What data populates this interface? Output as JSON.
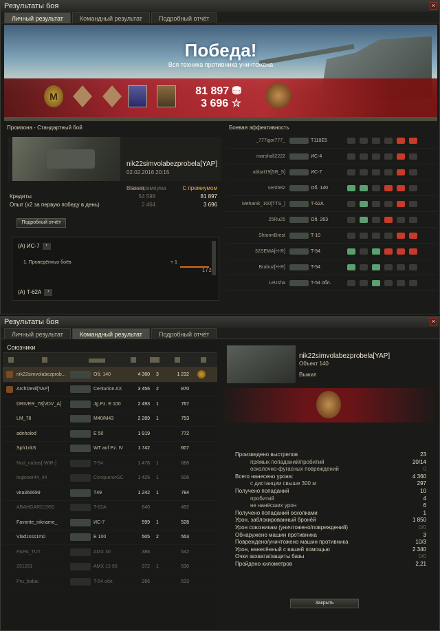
{
  "w1": {
    "title": "Результаты боя",
    "tabs": [
      "Личный результат",
      "Командный результат",
      "Подробный отчёт"
    ],
    "banner": {
      "title": "Победа!",
      "subtitle": "Вся техника противника уничтожена",
      "medal1": "M",
      "credits": "81 897",
      "xp": "3 696"
    },
    "left": {
      "header": "Промзона - Стандартный бой",
      "player": "nik22simvolabezprobela[YAP]",
      "date": "02.02.2016 20:15",
      "status": "Выжил",
      "col1": "Без премиума",
      "col2": "С премиумом",
      "rows": [
        {
          "label": "Кредиты",
          "v1": "54 598",
          "v2": "81 897"
        },
        {
          "label": "Опыт  (x2 за первую победу в день)",
          "v1": "2 464",
          "v2": "3 696"
        }
      ],
      "detail_button": "Подробный отчёт",
      "quest1": {
        "head": "(А) ИС-7",
        "task": "1. Проведённых боёв",
        "plus": "+ 1",
        "count": "1 / 2"
      },
      "quest2": {
        "head": "(А) T-62A"
      }
    },
    "right": {
      "header": "Боевая эффективность",
      "rows": [
        {
          "name": "_777igor777_",
          "vehicle": "T110E5"
        },
        {
          "name": "marshall2222",
          "vehicle": "ИС-4"
        },
        {
          "name": "abbat19[SB_S]",
          "vehicle": "ИС-7"
        },
        {
          "name": "ser0582",
          "vehicle": "Об. 140"
        },
        {
          "name": "Mehanik_100[TTS_]",
          "vehicle": "T-62A"
        },
        {
          "name": "25Ru25",
          "vehicle": "Об. 263"
        },
        {
          "name": "ShtormBrest",
          "vehicle": "T-10"
        },
        {
          "name": "32SEMA[H-R]",
          "vehicle": "T-54"
        },
        {
          "name": "Brabuz[H-R]",
          "vehicle": "T-54"
        },
        {
          "name": "LeUsha",
          "vehicle": "T-54 обл."
        }
      ]
    }
  },
  "w2": {
    "title": "Результаты боя",
    "tabs": [
      "Личный результат",
      "Командный результат",
      "Подробный отчёт"
    ],
    "allies_header": "Союзники",
    "team": [
      {
        "player": "nik22simvolabezprob...",
        "vehicle": "Об. 140",
        "damage": "4 360",
        "kills": "3",
        "xp": "1 232"
      },
      {
        "player": "ArchDevil[YAP]",
        "vehicle": "Centurion AX",
        "damage": "3 456",
        "kills": "2",
        "xp": "870"
      },
      {
        "player": "DRIVER_78[VDV_A]",
        "vehicle": "Jg.Pz. E 100",
        "damage": "2 493",
        "kills": "1",
        "xp": "767"
      },
      {
        "player": "LM_78",
        "vehicle": "M40/M43",
        "damage": "2 289",
        "kills": "1",
        "xp": "753"
      },
      {
        "player": "adnholod",
        "vehicle": "E 50",
        "damage": "1 919",
        "kills": "",
        "xp": "772"
      },
      {
        "player": "Sph1nkS",
        "vehicle": "WT auf Pz. IV",
        "damage": "1 742",
        "kills": "",
        "xp": "607"
      },
      {
        "player": "Nud_nubas[-WIR-]",
        "vehicle": "T-54",
        "damage": "1 476",
        "kills": "1",
        "xp": "688"
      },
      {
        "player": "legioner44_44",
        "vehicle": "ConquerorGC",
        "damage": "1 425",
        "kills": "1",
        "xp": "506"
      },
      {
        "player": "vira366699",
        "vehicle": "T49",
        "damage": "1 242",
        "kills": "1",
        "xp": "784"
      },
      {
        "player": "ABAHGARD1950",
        "vehicle": "T-62A",
        "damage": "640",
        "kills": "",
        "xp": "492"
      },
      {
        "player": "Favorite_nikname_",
        "vehicle": "ИС-7",
        "damage": "599",
        "kills": "1",
        "xp": "528"
      },
      {
        "player": "Vlad1sss1m0",
        "vehicle": "E 100",
        "damage": "505",
        "kills": "2",
        "xp": "553"
      },
      {
        "player": "PAPA_TUT",
        "vehicle": "AMX 30",
        "damage": "386",
        "kills": "",
        "xp": "542"
      },
      {
        "player": "291291",
        "vehicle": "AMX 13 90",
        "damage": "372",
        "kills": "1",
        "xp": "530"
      },
      {
        "player": "Pru_babai",
        "vehicle": "T-54 обл.",
        "damage": "266",
        "kills": "",
        "xp": "533"
      }
    ],
    "detail": {
      "player": "nik22simvolabezprobela[YAP]",
      "vehicle": "Объект 140",
      "status": "Выжил",
      "stats": [
        {
          "l": "Произведено выстрелов",
          "r": "23"
        },
        {
          "l": "прямых попаданий/пробитий",
          "r": "20/14",
          "ind": true
        },
        {
          "l": "осколочно-фугасных повреждений",
          "r": "0",
          "ind": true,
          "dim": true
        },
        {
          "l": "Всего нанесено урона:",
          "r": "4 360"
        },
        {
          "l": "с дистанции свыше 300 м",
          "r": "297",
          "ind": true
        },
        {
          "l": "Получено попаданий",
          "r": "10"
        },
        {
          "l": "пробитий",
          "r": "4",
          "ind": true
        },
        {
          "l": "не нанёсших урон",
          "r": "6",
          "ind": true
        },
        {
          "l": "Получено попаданий осколками",
          "r": "1"
        },
        {
          "l": "Урон, заблокированный бронёй",
          "r": "1 850"
        },
        {
          "l": "Урон союзникам (уничтожено/повреждений)",
          "r": "0/0",
          "dim": true
        },
        {
          "l": "Обнаружено машин противника",
          "r": "3"
        },
        {
          "l": "Повреждено/уничтожено машин противника",
          "r": "10/3"
        },
        {
          "l": "Урон, нанесённый с вашей помощью",
          "r": "2 340"
        },
        {
          "l": "Очки захвата/защиты базы",
          "r": "0/0",
          "dim": true
        },
        {
          "l": "Пройдено километров",
          "r": "2,21"
        }
      ],
      "close_button": "Закрыть"
    }
  }
}
